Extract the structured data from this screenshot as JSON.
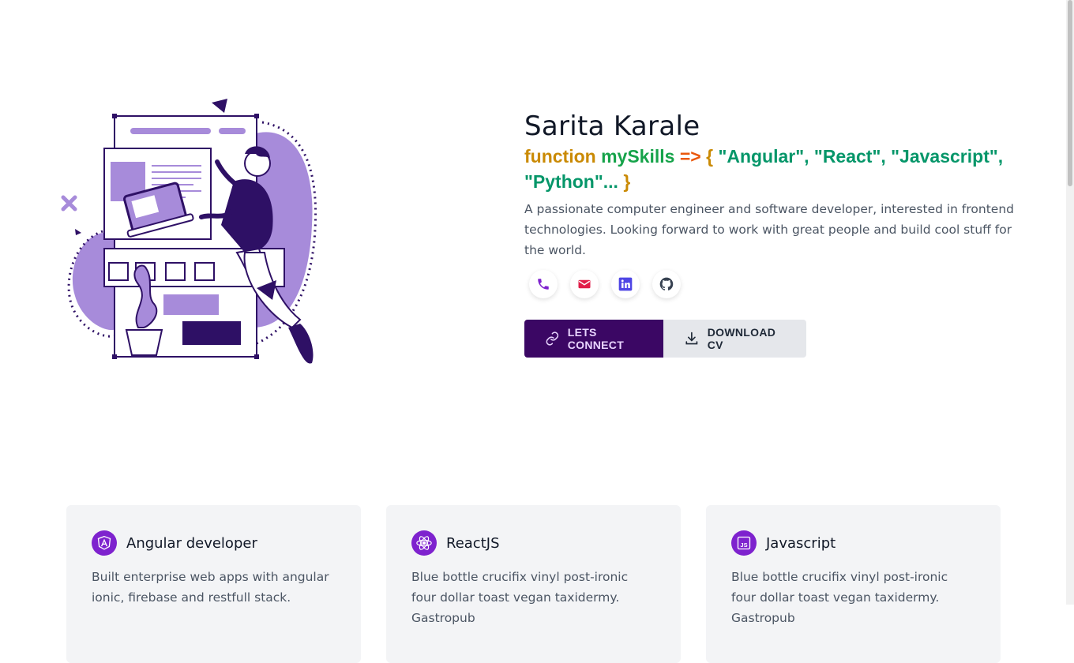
{
  "hero": {
    "name": "Sarita Karale",
    "skills": {
      "keyword": "function",
      "fn_name": "mySkills",
      "arrow": "=>",
      "open_brace": "{",
      "items": "\"Angular\", \"React\", \"Javascript\", \"Python\"...",
      "close_brace": "}"
    },
    "description": "A passionate computer engineer and software developer, interested in frontend technologies. Looking forward to work with great people and build cool stuff for the world."
  },
  "socials": [
    {
      "icon": "phone-icon",
      "color": "#7e22ce"
    },
    {
      "icon": "mail-icon",
      "color": "#e11d48"
    },
    {
      "icon": "linkedin-icon",
      "color": "#4f46e5"
    },
    {
      "icon": "github-icon",
      "color": "#374151"
    }
  ],
  "actions": {
    "connect_label": "LETS CONNECT",
    "download_label": "DOWNLOAD CV"
  },
  "cards": [
    {
      "icon": "angular-icon",
      "title": "Angular developer",
      "text": "Built enterprise web apps with angular ionic, firebase and restfull stack."
    },
    {
      "icon": "react-icon",
      "title": "ReactJS",
      "text": "Blue bottle crucifix vinyl post-ironic four dollar toast vegan taxidermy. Gastropub"
    },
    {
      "icon": "javascript-icon",
      "title": "Javascript",
      "text": "Blue bottle crucifix vinyl post-ironic four dollar toast vegan taxidermy. Gastropub"
    }
  ],
  "colors": {
    "accent": "#7e22ce",
    "primary_button": "#3b0764",
    "illustration_purple": "#a78bda"
  }
}
